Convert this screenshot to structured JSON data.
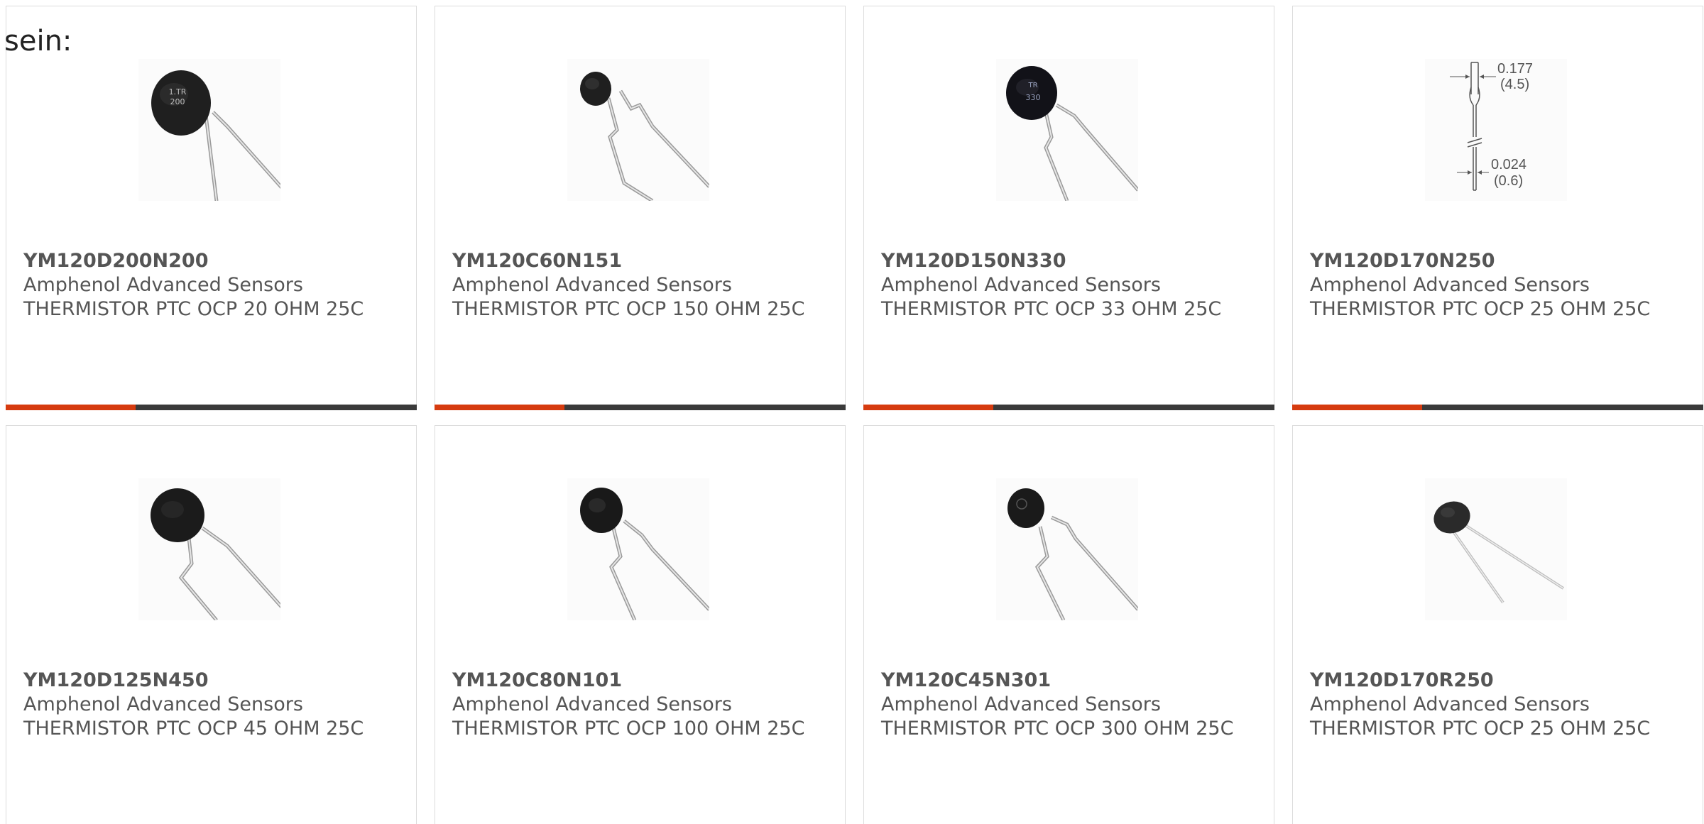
{
  "intro_text": "sein:",
  "colors": {
    "accent": "#d63b0f",
    "bar": "#3a3a3a",
    "text": "#555555",
    "border": "#dcdcdc"
  },
  "products": [
    {
      "part_number": "YM120D200N200",
      "manufacturer": "Amphenol Advanced Sensors",
      "description": "THERMISTOR PTC OCP 20 OHM 25C",
      "image_icon": "thermistor-disc-icon",
      "marking": [
        "1.TR",
        "200"
      ]
    },
    {
      "part_number": "YM120C60N151",
      "manufacturer": "Amphenol Advanced Sensors",
      "description": "THERMISTOR PTC OCP 150 OHM 25C",
      "image_icon": "thermistor-disc-icon",
      "marking": []
    },
    {
      "part_number": "YM120D150N330",
      "manufacturer": "Amphenol Advanced Sensors",
      "description": "THERMISTOR PTC OCP 33 OHM 25C",
      "image_icon": "thermistor-disc-icon",
      "marking": [
        "TR",
        "330"
      ]
    },
    {
      "part_number": "YM120D170N250",
      "manufacturer": "Amphenol Advanced Sensors",
      "description": "THERMISTOR PTC OCP 25 OHM 25C",
      "image_icon": "dimension-drawing-icon",
      "dimensions": [
        "0.177",
        "(4.5)",
        "0.024",
        "(0.6)"
      ]
    },
    {
      "part_number": "YM120D125N450",
      "manufacturer": "Amphenol Advanced Sensors",
      "description": "THERMISTOR PTC OCP 45 OHM 25C",
      "image_icon": "thermistor-disc-icon",
      "marking": []
    },
    {
      "part_number": "YM120C80N101",
      "manufacturer": "Amphenol Advanced Sensors",
      "description": "THERMISTOR PTC OCP 100 OHM 25C",
      "image_icon": "thermistor-disc-icon",
      "marking": []
    },
    {
      "part_number": "YM120C45N301",
      "manufacturer": "Amphenol Advanced Sensors",
      "description": "THERMISTOR PTC OCP 300 OHM 25C",
      "image_icon": "thermistor-disc-icon",
      "marking": []
    },
    {
      "part_number": "YM120D170R250",
      "manufacturer": "Amphenol Advanced Sensors",
      "description": "THERMISTOR PTC OCP 25 OHM 25C",
      "image_icon": "thermistor-disc-icon",
      "marking": []
    }
  ]
}
